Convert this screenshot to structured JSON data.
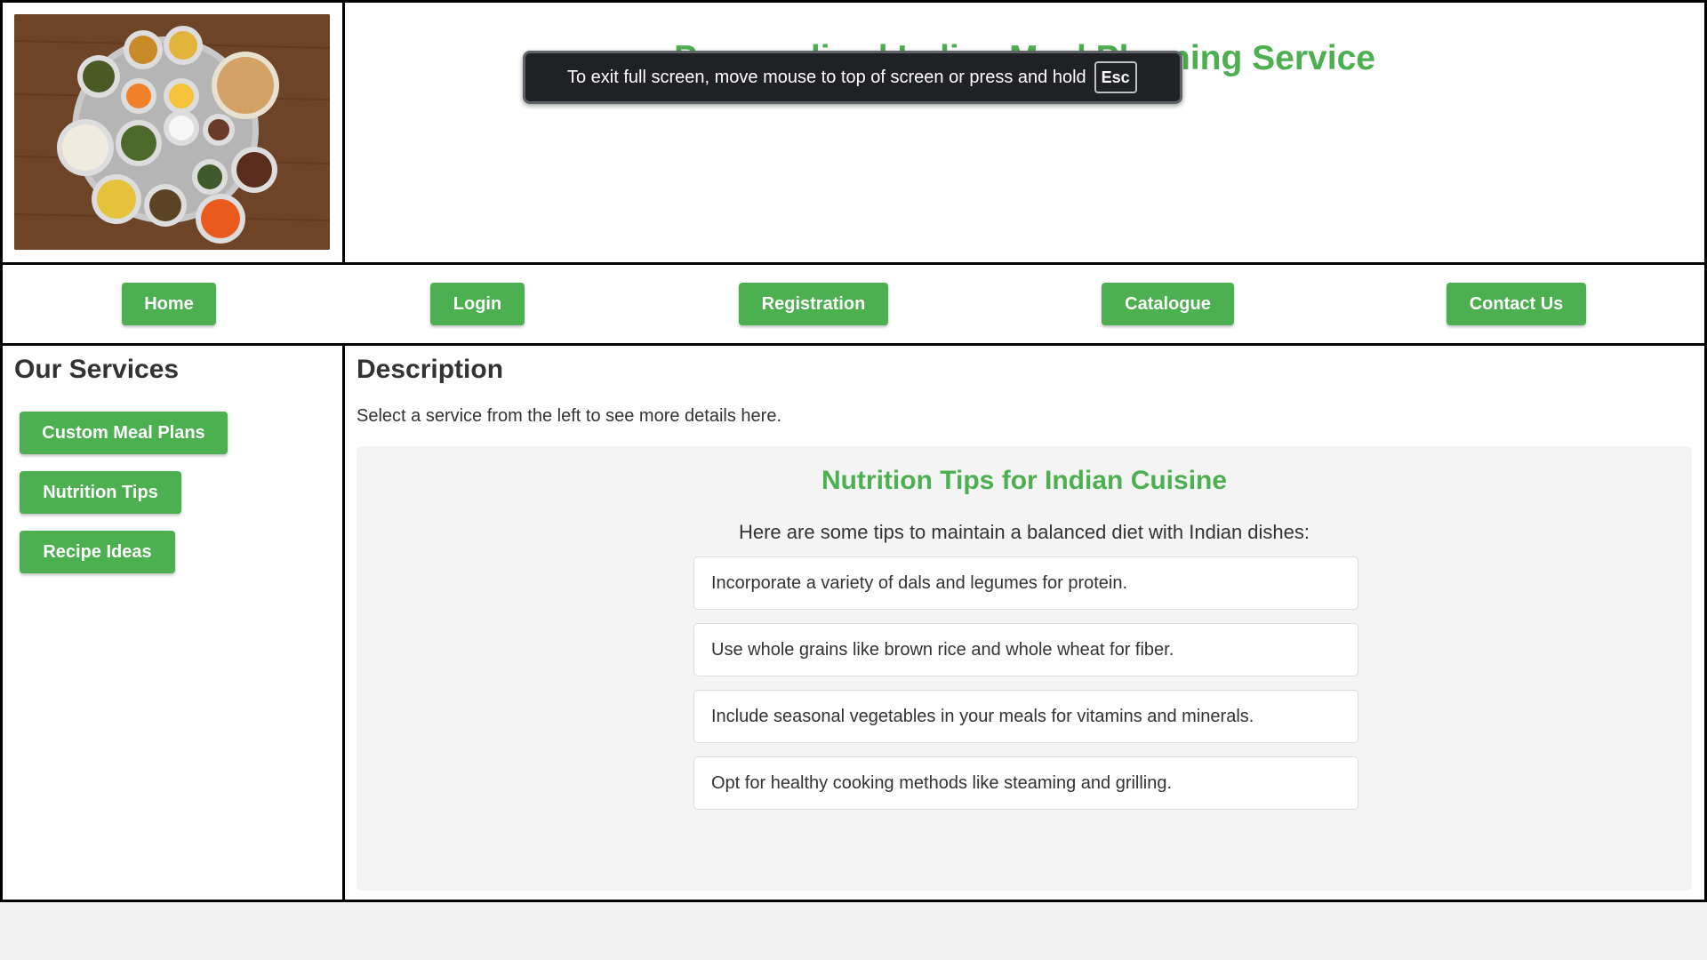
{
  "header": {
    "logo_alt": "Indian thali spread",
    "site_title": "Personalized Indian Meal Planning Service"
  },
  "nav": {
    "items": [
      {
        "label": "Home"
      },
      {
        "label": "Login"
      },
      {
        "label": "Registration"
      },
      {
        "label": "Catalogue"
      },
      {
        "label": "Contact Us"
      }
    ]
  },
  "sidebar": {
    "heading": "Our Services",
    "items": [
      {
        "label": "Custom Meal Plans"
      },
      {
        "label": "Nutrition Tips"
      },
      {
        "label": "Recipe Ideas"
      }
    ]
  },
  "main": {
    "heading": "Description",
    "text": "Select a service from the left to see more details here.",
    "panel": {
      "title": "Nutrition Tips for Indian Cuisine",
      "intro": "Here are some tips to maintain a balanced diet with Indian dishes:",
      "tips": [
        "Incorporate a variety of dals and legumes for protein.",
        "Use whole grains like brown rice and whole wheat for fiber.",
        "Include seasonal vegetables in your meals for vitamins and minerals.",
        "Opt for healthy cooking methods like steaming and grilling."
      ]
    }
  },
  "fullscreen_notice": {
    "message": "To exit full screen, move mouse to top of screen or press and hold",
    "key": "Esc"
  },
  "colors": {
    "accent": "#4caf50",
    "panel_bg": "#f4f4f4",
    "toast_bg": "#202124"
  }
}
